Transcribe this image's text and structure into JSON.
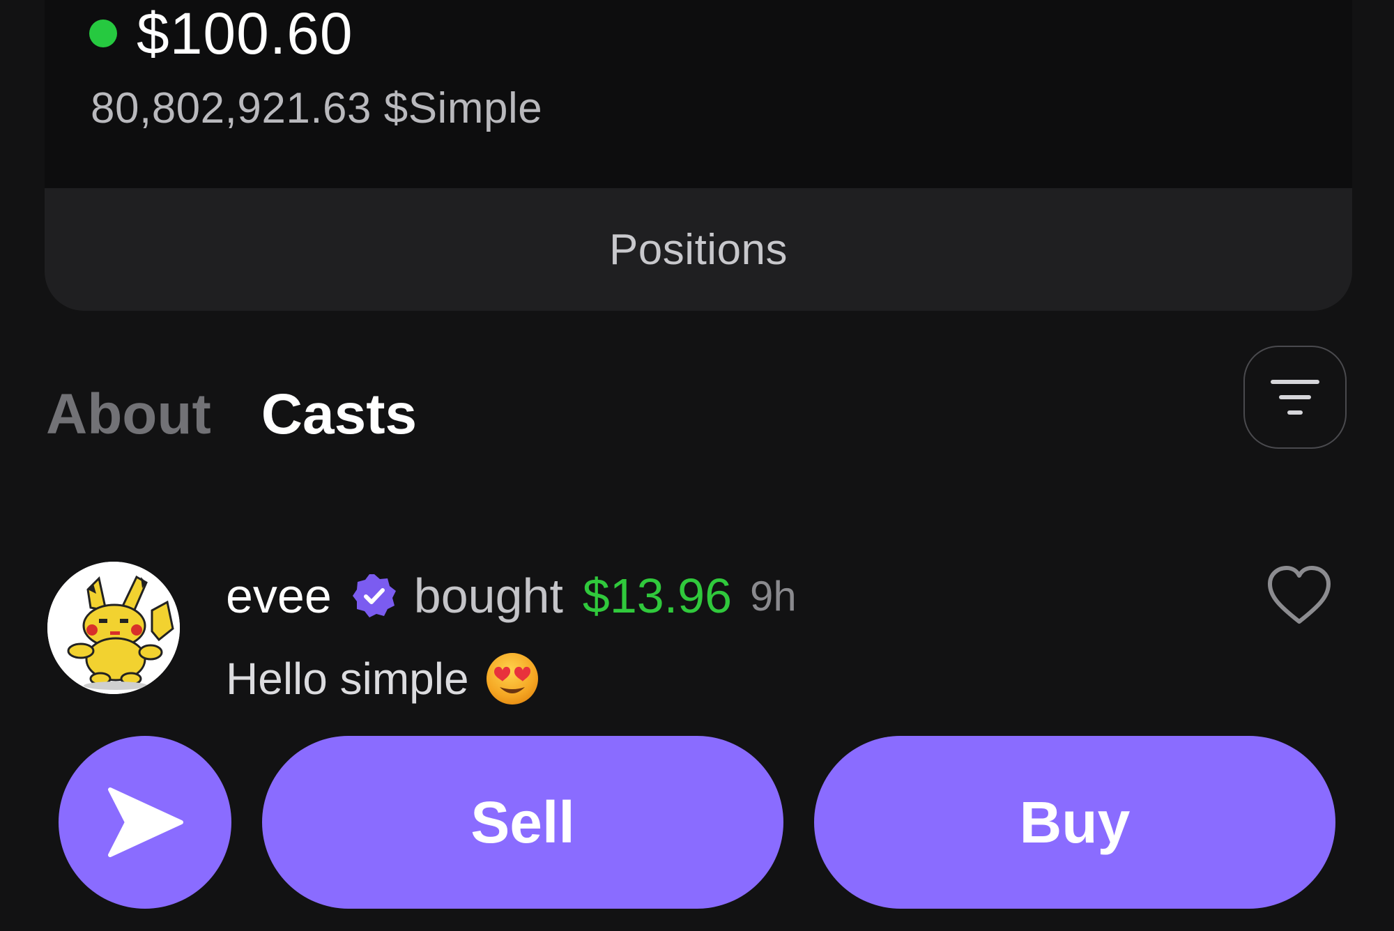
{
  "balance": {
    "value": "$100.60",
    "token_amount": "80,802,921.63 $Simple",
    "status_color": "#26c940"
  },
  "positions": {
    "label": "Positions"
  },
  "tabs": [
    {
      "label": "About",
      "active": false
    },
    {
      "label": "Casts",
      "active": true
    }
  ],
  "filter": {
    "icon": "filter-icon"
  },
  "cast": {
    "user": "evee",
    "verified": true,
    "action": "bought",
    "amount": "$13.96",
    "time": "9h",
    "text": "Hello simple",
    "emoji": "heart-eyes-emoji",
    "avatar_icon": "pikachu-avatar",
    "like_icon": "heart-icon"
  },
  "actions": {
    "send_icon": "send-icon",
    "sell_label": "Sell",
    "buy_label": "Buy"
  },
  "colors": {
    "accent": "#8a6cff",
    "positive": "#30c93c",
    "background": "#121213",
    "card": "#0d0d0e"
  }
}
